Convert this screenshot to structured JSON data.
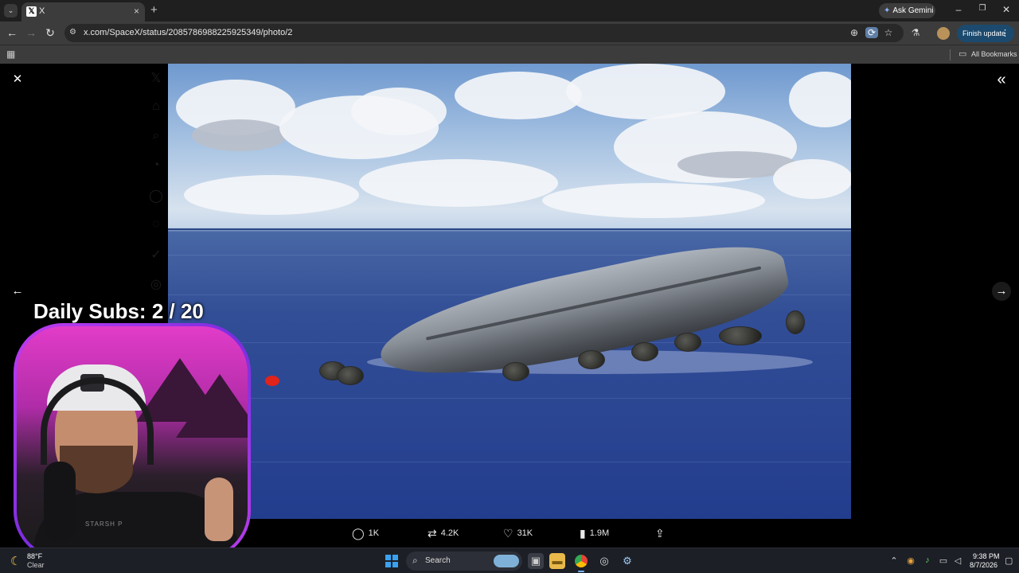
{
  "browser": {
    "tab": {
      "favicon": "𝕏",
      "title": "X",
      "close": "×"
    },
    "new_tab": "+",
    "ask_gemini": "Ask Gemini",
    "window_controls": {
      "minimize": "–",
      "maximize": "❐",
      "close": "✕"
    },
    "url": "x.com/SpaceX/status/2085786988225925349/photo/2",
    "finish_update": "Finish update",
    "bookmarks_label": "All Bookmarks"
  },
  "icons": {
    "back": "←",
    "forward": "→",
    "reload": "↻",
    "site_info": "⚙",
    "zoom": "⊕",
    "extension": "⟳",
    "star": "☆",
    "extensions_menu": "⚗",
    "menu_dots": "⋮",
    "apps": "▦",
    "folder": "▭",
    "close_viewer": "✕",
    "collapse": "«",
    "prev": "←",
    "next": "→",
    "reply": "◯",
    "repost": "⇄",
    "like": "♡",
    "views": "▮",
    "share": "⇪"
  },
  "post": {
    "replies": "1K",
    "reposts": "4.2K",
    "likes": "31K",
    "views": "1.9M"
  },
  "stream_overlay": {
    "sub_goal": "Daily Subs: 2 / 20",
    "shirt_text": "STARSH P"
  },
  "taskbar": {
    "weather_temp": "88°F",
    "weather_condition": "Clear",
    "search_label": "Search",
    "time": "9:38 PM",
    "date": "8/7/2026"
  },
  "colors": {
    "accent_blue": "#1c4a6e",
    "webcam_border": "#c03cf0",
    "buoy_red": "#e0231b"
  }
}
